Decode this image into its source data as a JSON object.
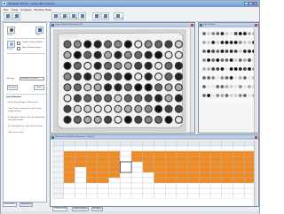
{
  "window": {
    "title": "TotalLab TL100 - Array [Microarray]",
    "min": "–",
    "max": "□",
    "close": "×"
  },
  "menu": [
    "File",
    "View",
    "Analysis",
    "Window",
    "Help"
  ],
  "toolbar": {
    "buttons": [
      {
        "icon": "open-icon",
        "label": "Open"
      },
      {
        "icon": "save-icon",
        "label": "Save"
      },
      {
        "icon": "print-icon",
        "label": "Print"
      },
      {
        "icon": "export-icon",
        "label": "Export"
      },
      {
        "icon": "settings-icon",
        "label": "Settings"
      },
      {
        "icon": "help-icon",
        "label": "Help"
      },
      {
        "icon": "grid-icon",
        "label": "Grid"
      },
      {
        "icon": "spots-icon",
        "label": "Spots"
      },
      {
        "icon": "full-image-icon",
        "label": "Full Image"
      }
    ]
  },
  "left_panel": {
    "top_icons": [
      {
        "icon": "detect-icon",
        "label": "Detect"
      },
      {
        "icon": "clear-icon",
        "label": "Clear"
      }
    ],
    "checks": [
      {
        "label": "Create & Stretch Block"
      },
      {
        "label": "Move & Resize Spots"
      }
    ],
    "side_icon_label": "Detect",
    "grid_type_label": "Grid type",
    "grid_type_value": "Microtitre (96 well)",
    "nav": {
      "prev": "Previous",
      "next": "Next"
    },
    "section_title": "Spot Definition",
    "bullets": [
      "Select the grid type in Parameters",
      "Click Detect or drag out a grid on the image window",
      "To add grid or spots, click the appropriate tool mode button",
      "To view properties, right click on a spot",
      "Click next to keep"
    ],
    "tabs": [
      "Instructions",
      "Parameters"
    ]
  },
  "image_window": {
    "title": "Image Window [Microarray 96]"
  },
  "stack_window": {
    "title": "Stack Window"
  },
  "measurement_window": {
    "title": "Measurement Window [Microarray / Volume]"
  },
  "bottom_tabs": [
    "Corrected Vol",
    "Selected Spots",
    "All Spots"
  ],
  "colors": {
    "highlight": "#f08a24",
    "title_blue": "#6f98cf"
  }
}
